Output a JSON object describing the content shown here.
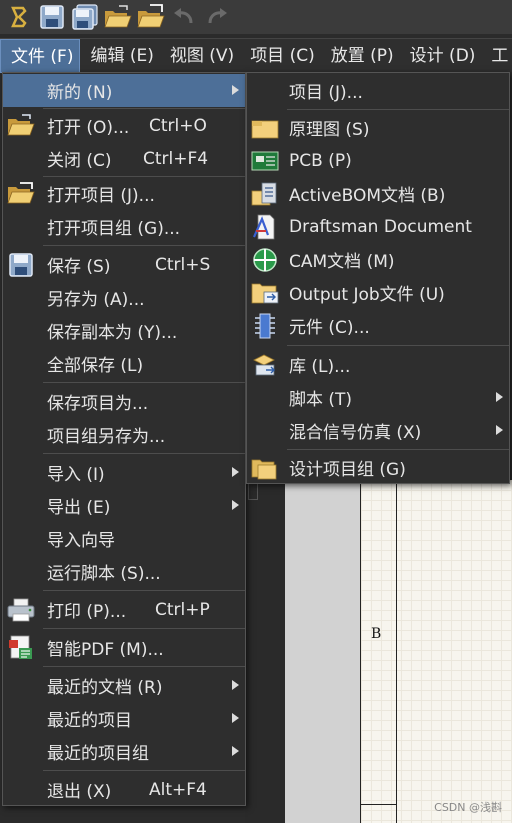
{
  "menubar": {
    "items": [
      "文件 (F)",
      "编辑 (E)",
      "视图 (V)",
      "项目 (C)",
      "放置 (P)",
      "设计 (D)",
      "工"
    ]
  },
  "file_menu": {
    "items": [
      {
        "label": "新的 (N)",
        "shortcut": "",
        "submenu": true
      },
      {
        "label": "打开 (O)...",
        "shortcut": "Ctrl+O"
      },
      {
        "label": "关闭 (C)",
        "shortcut": "Ctrl+F4"
      },
      {
        "label": "打开项目 (J)...",
        "shortcut": ""
      },
      {
        "label": "打开项目组 (G)...",
        "shortcut": ""
      },
      {
        "label": "保存 (S)",
        "shortcut": "Ctrl+S"
      },
      {
        "label": "另存为 (A)...",
        "shortcut": ""
      },
      {
        "label": "保存副本为 (Y)...",
        "shortcut": ""
      },
      {
        "label": "全部保存 (L)",
        "shortcut": ""
      },
      {
        "label": "保存项目为...",
        "shortcut": ""
      },
      {
        "label": "项目组另存为...",
        "shortcut": ""
      },
      {
        "label": "导入 (I)",
        "shortcut": "",
        "submenu": true
      },
      {
        "label": "导出 (E)",
        "shortcut": "",
        "submenu": true
      },
      {
        "label": "导入向导",
        "shortcut": ""
      },
      {
        "label": "运行脚本 (S)...",
        "shortcut": ""
      },
      {
        "label": "打印 (P)...",
        "shortcut": "Ctrl+P"
      },
      {
        "label": "智能PDF (M)...",
        "shortcut": ""
      },
      {
        "label": "最近的文档 (R)",
        "shortcut": "",
        "submenu": true
      },
      {
        "label": "最近的项目",
        "shortcut": "",
        "submenu": true
      },
      {
        "label": "最近的项目组",
        "shortcut": "",
        "submenu": true
      },
      {
        "label": "退出 (X)",
        "shortcut": "Alt+F4"
      }
    ]
  },
  "new_submenu": {
    "items": [
      {
        "label": "项目 (J)..."
      },
      {
        "label": "原理图 (S)"
      },
      {
        "label": "PCB (P)"
      },
      {
        "label": "ActiveBOM文档 (B)"
      },
      {
        "label": "Draftsman Document"
      },
      {
        "label": "CAM文档 (M)"
      },
      {
        "label": "Output Job文件 (U)"
      },
      {
        "label": "元件 (C)..."
      },
      {
        "label": "库 (L)..."
      },
      {
        "label": "脚本 (T)",
        "submenu": true
      },
      {
        "label": "混合信号仿真 (X)",
        "submenu": true
      },
      {
        "label": "设计项目组 (G)"
      }
    ]
  },
  "workspace": {
    "sheet_label": "B"
  },
  "watermark": "CSDN @浅斟",
  "colors": {
    "highlight": "#4d6f98",
    "menu_bg": "#2e2e2e",
    "toolbar_bg": "#3b3b3b"
  }
}
